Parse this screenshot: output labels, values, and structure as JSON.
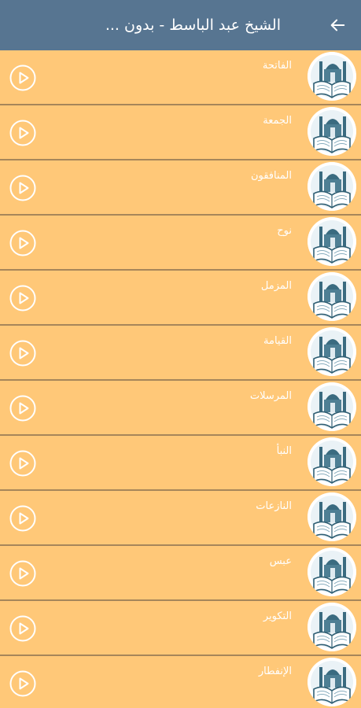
{
  "header": {
    "title": "الشيخ عبد الباسط - بدون ...",
    "back_icon": "arrow-back-icon"
  },
  "surahs": [
    {
      "name": "الفاتحة"
    },
    {
      "name": "الجمعة"
    },
    {
      "name": "المنافقون"
    },
    {
      "name": "نوح"
    },
    {
      "name": "المزمل"
    },
    {
      "name": "القيامة"
    },
    {
      "name": "المرسلات"
    },
    {
      "name": "النبأ"
    },
    {
      "name": "النازعات"
    },
    {
      "name": "عبس"
    },
    {
      "name": "التكوير"
    },
    {
      "name": "الإنفطار"
    }
  ],
  "colors": {
    "appbar": "#577591",
    "background": "#ffc878",
    "divider": "#a6865a",
    "text": "#ffffff"
  }
}
